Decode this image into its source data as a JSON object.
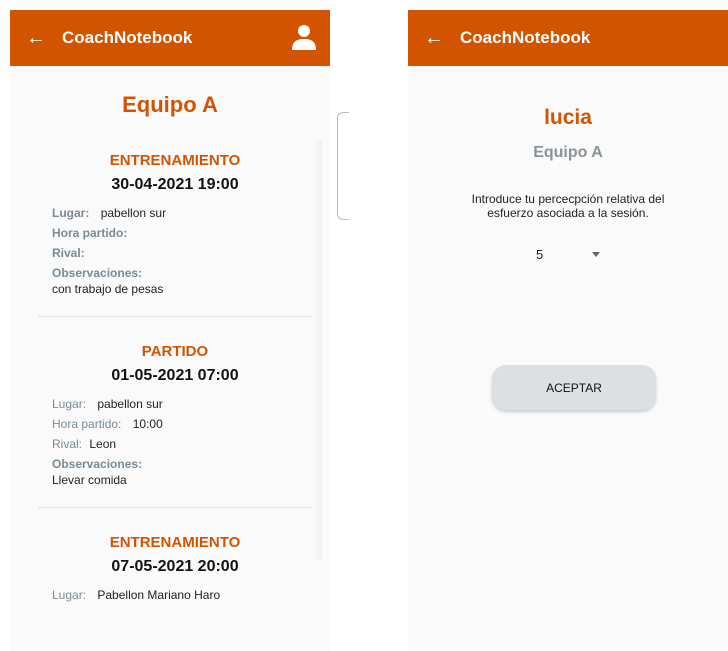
{
  "colors": {
    "primary": "#d35400",
    "label": "#7b8a95",
    "button_bg": "#dde0e3"
  },
  "left": {
    "appbar": {
      "back_icon": "←",
      "title": "CoachNotebook",
      "user_icon": "user-icon"
    },
    "team_title": "Equipo A",
    "labels": {
      "lugar": "Lugar:",
      "hora": "Hora partido:",
      "rival": "Rival:",
      "obs": "Observaciones:"
    },
    "events": [
      {
        "type": "ENTRENAMIENTO",
        "datetime": "30-04-2021 19:00",
        "lugar": "pabellon sur",
        "hora": "",
        "rival": "",
        "obs": "con trabajo de pesas"
      },
      {
        "type": "PARTIDO",
        "datetime": "01-05-2021 07:00",
        "lugar": "pabellon sur",
        "hora": "10:00",
        "rival": "Leon",
        "obs": "Llevar comida"
      },
      {
        "type": "ENTRENAMIENTO",
        "datetime": "07-05-2021 20:00",
        "lugar": "Pabellon Mariano Haro"
      }
    ]
  },
  "right": {
    "appbar": {
      "back_icon": "←",
      "title": "CoachNotebook"
    },
    "player": "lucia",
    "team": "Equipo A",
    "prompt": "Introduce tu percecpción relativa del esfuerzo asociada a la sesión.",
    "rpe_value": "5",
    "accept_label": "ACEPTAR"
  }
}
